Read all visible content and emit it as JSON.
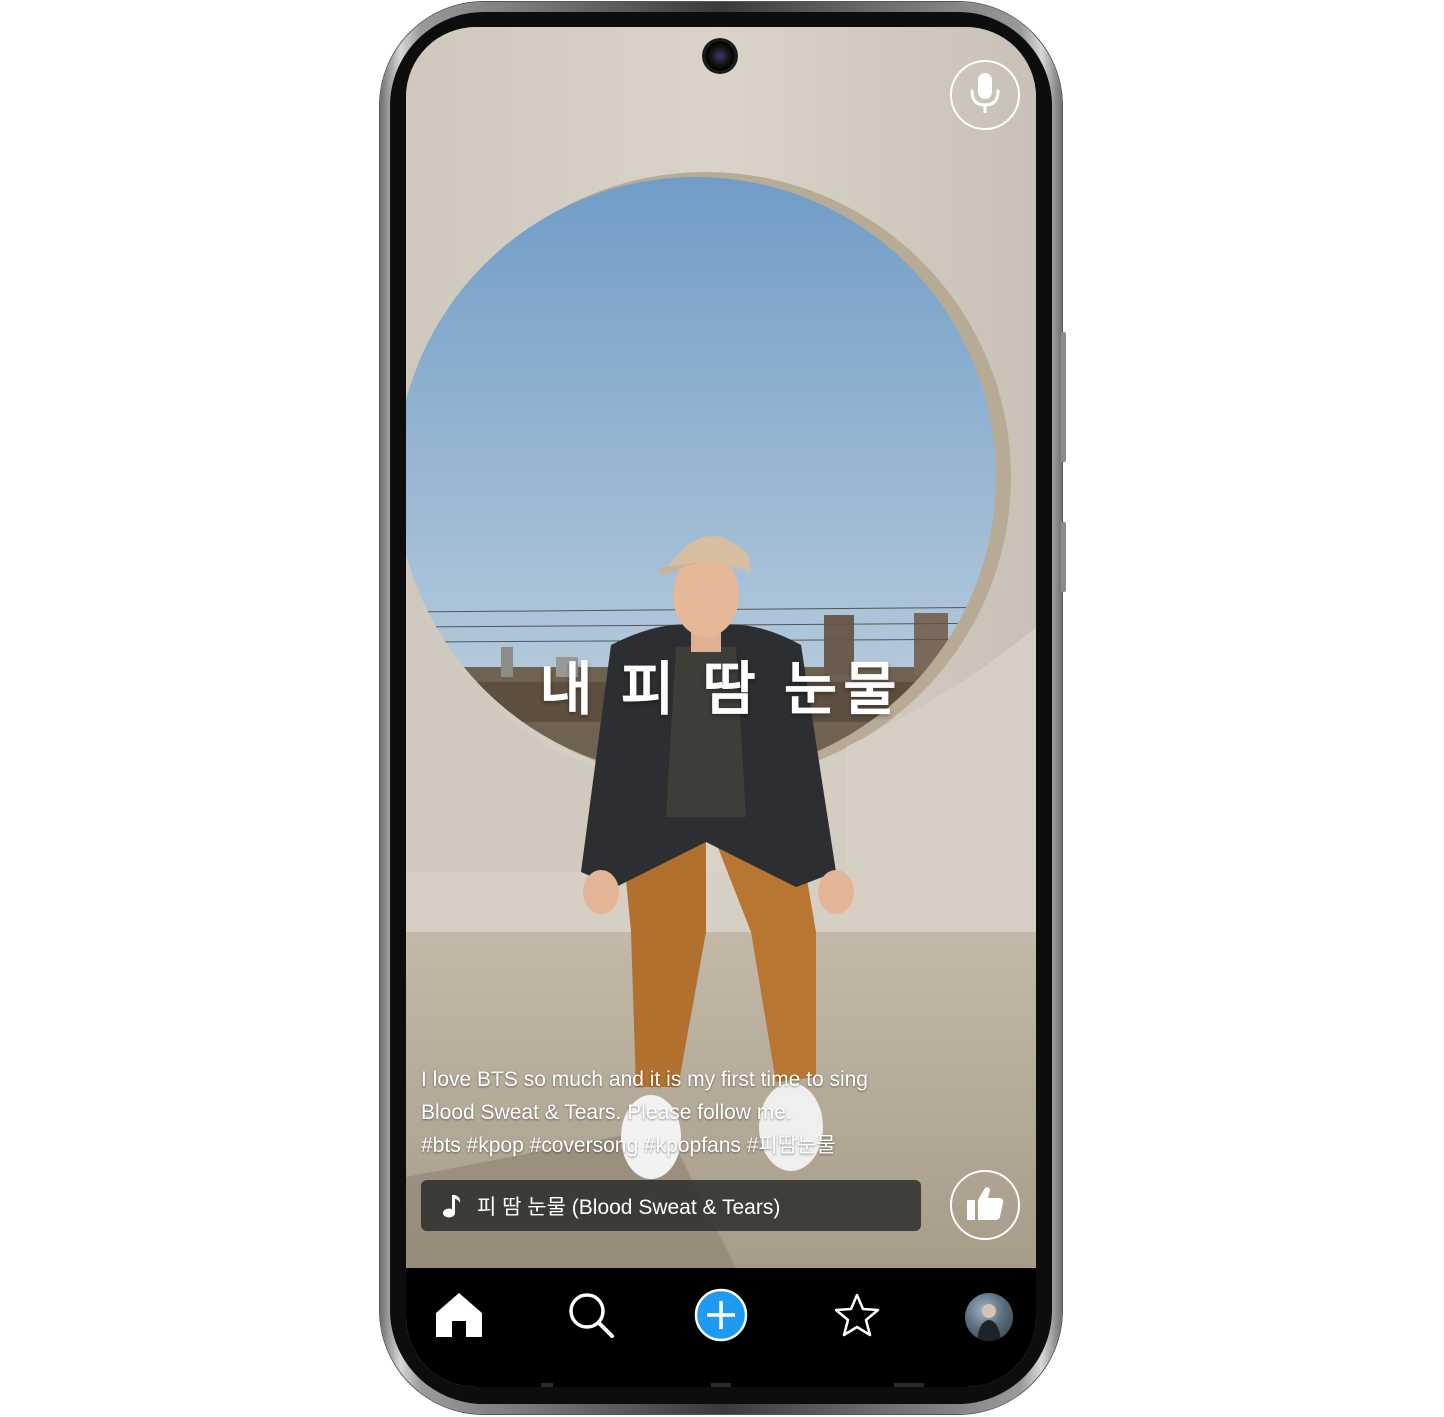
{
  "post": {
    "title": "내 피 땀 눈물",
    "caption_lines": [
      "I love BTS so much and it is my first time to sing",
      "Blood Sweat & Tears. Please follow me.",
      "#bts #kpop #coversong #kpopfans #피땀눈물"
    ],
    "music_label": "피 땀 눈물 (Blood Sweat & Tears)"
  },
  "icons": {
    "top_right": "microphone-icon",
    "reaction": "thumbs-up-icon",
    "music": "music-note-icon",
    "nav": [
      "home-icon",
      "search-icon",
      "add-icon",
      "star-icon",
      "profile-avatar"
    ]
  },
  "colors": {
    "accent": "#1e9bf0",
    "nav_background": "#000000",
    "music_bar": "#2a2a2a",
    "sky": "#8fb3d2",
    "wall": "#d4cfc8"
  }
}
